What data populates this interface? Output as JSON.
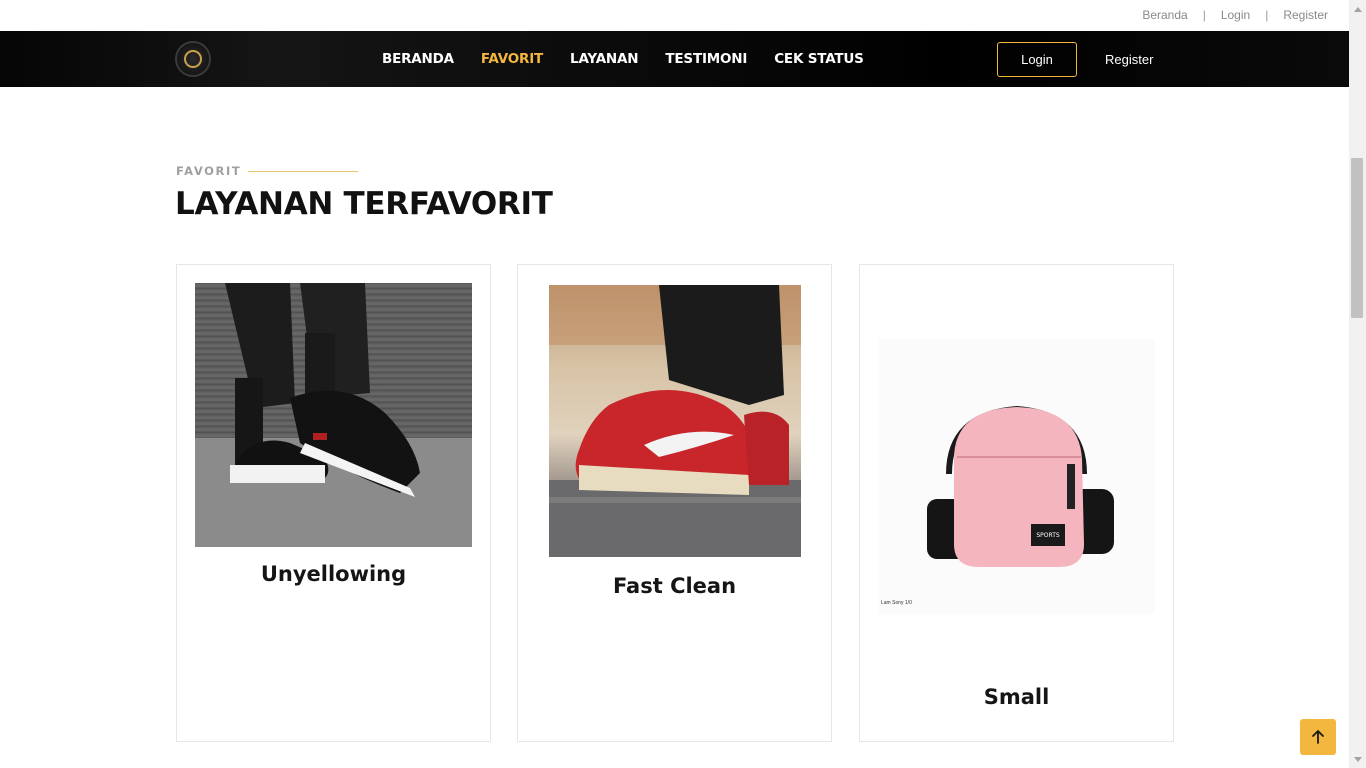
{
  "topbar": {
    "links": [
      {
        "label": "Beranda"
      },
      {
        "label": "Login"
      },
      {
        "label": "Register"
      }
    ],
    "separator": "|"
  },
  "navbar": {
    "logo_icon": "brand-logo-icon",
    "items": [
      {
        "label": "BERANDA",
        "active": false
      },
      {
        "label": "FAVORIT",
        "active": true
      },
      {
        "label": "LAYANAN",
        "active": false
      },
      {
        "label": "TESTIMONI",
        "active": false
      },
      {
        "label": "CEK STATUS",
        "active": false
      }
    ],
    "login_label": "Login",
    "register_label": "Register"
  },
  "section": {
    "subtitle": "FAVORIT",
    "title": "LAYANAN TERFAVORIT"
  },
  "cards": [
    {
      "title": "Unyellowing",
      "image": "black-sneaker-photo"
    },
    {
      "title": "Fast Clean",
      "image": "red-sneaker-photo"
    },
    {
      "title": "Small",
      "image": "pink-bag-photo",
      "image_caption": "Lam Sony 1/0"
    }
  ],
  "back_to_top_icon": "arrow-up-icon",
  "colors": {
    "accent": "#f3b740",
    "nav_background": "#000000",
    "text": "#111111"
  }
}
